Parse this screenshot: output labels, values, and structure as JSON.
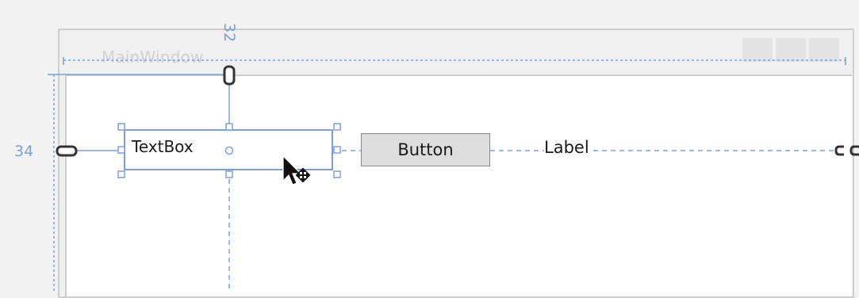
{
  "window": {
    "title": "MainWindow"
  },
  "margins": {
    "top": "32",
    "left": "34"
  },
  "controls": {
    "textbox": "TextBox",
    "button": "Button",
    "label": "Label"
  },
  "colors": {
    "guide": "#7ba0de",
    "frame": "#cfcfcf",
    "control_fill": "#dddddd"
  }
}
